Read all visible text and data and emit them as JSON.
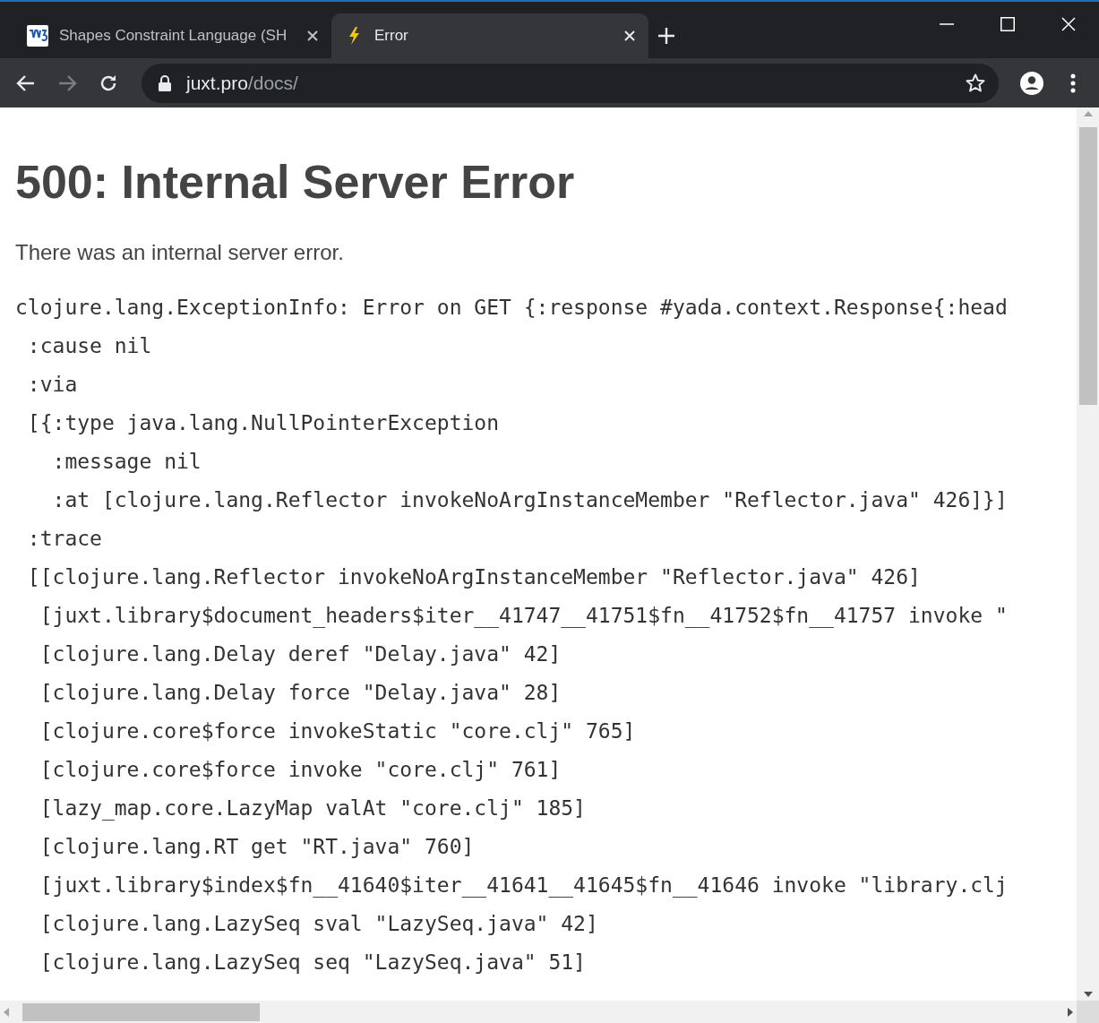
{
  "tabs": [
    {
      "title": "Shapes Constraint Language (SH",
      "kind": "w3c",
      "selected": false
    },
    {
      "title": "Error",
      "kind": "bolt",
      "selected": true
    }
  ],
  "address_bar": {
    "host": "juxt.pro",
    "path": "/docs/"
  },
  "navigation": {
    "back_disabled": false,
    "forward_disabled": true
  },
  "page": {
    "heading": "500: Internal Server Error",
    "message": "There was an internal server error.",
    "trace_lines": [
      "clojure.lang.ExceptionInfo: Error on GET {:response #yada.context.Response{:head",
      " :cause nil",
      " :via",
      " [{:type java.lang.NullPointerException",
      "   :message nil",
      "   :at [clojure.lang.Reflector invokeNoArgInstanceMember \"Reflector.java\" 426]}]",
      " :trace",
      " [[clojure.lang.Reflector invokeNoArgInstanceMember \"Reflector.java\" 426]",
      "  [juxt.library$document_headers$iter__41747__41751$fn__41752$fn__41757 invoke \"",
      "  [clojure.lang.Delay deref \"Delay.java\" 42]",
      "  [clojure.lang.Delay force \"Delay.java\" 28]",
      "  [clojure.core$force invokeStatic \"core.clj\" 765]",
      "  [clojure.core$force invoke \"core.clj\" 761]",
      "  [lazy_map.core.LazyMap valAt \"core.clj\" 185]",
      "  [clojure.lang.RT get \"RT.java\" 760]",
      "  [juxt.library$index$fn__41640$iter__41641__41645$fn__41646 invoke \"library.clj",
      "  [clojure.lang.LazySeq sval \"LazySeq.java\" 42]",
      "  [clojure.lang.LazySeq seq \"LazySeq.java\" 51]"
    ]
  }
}
